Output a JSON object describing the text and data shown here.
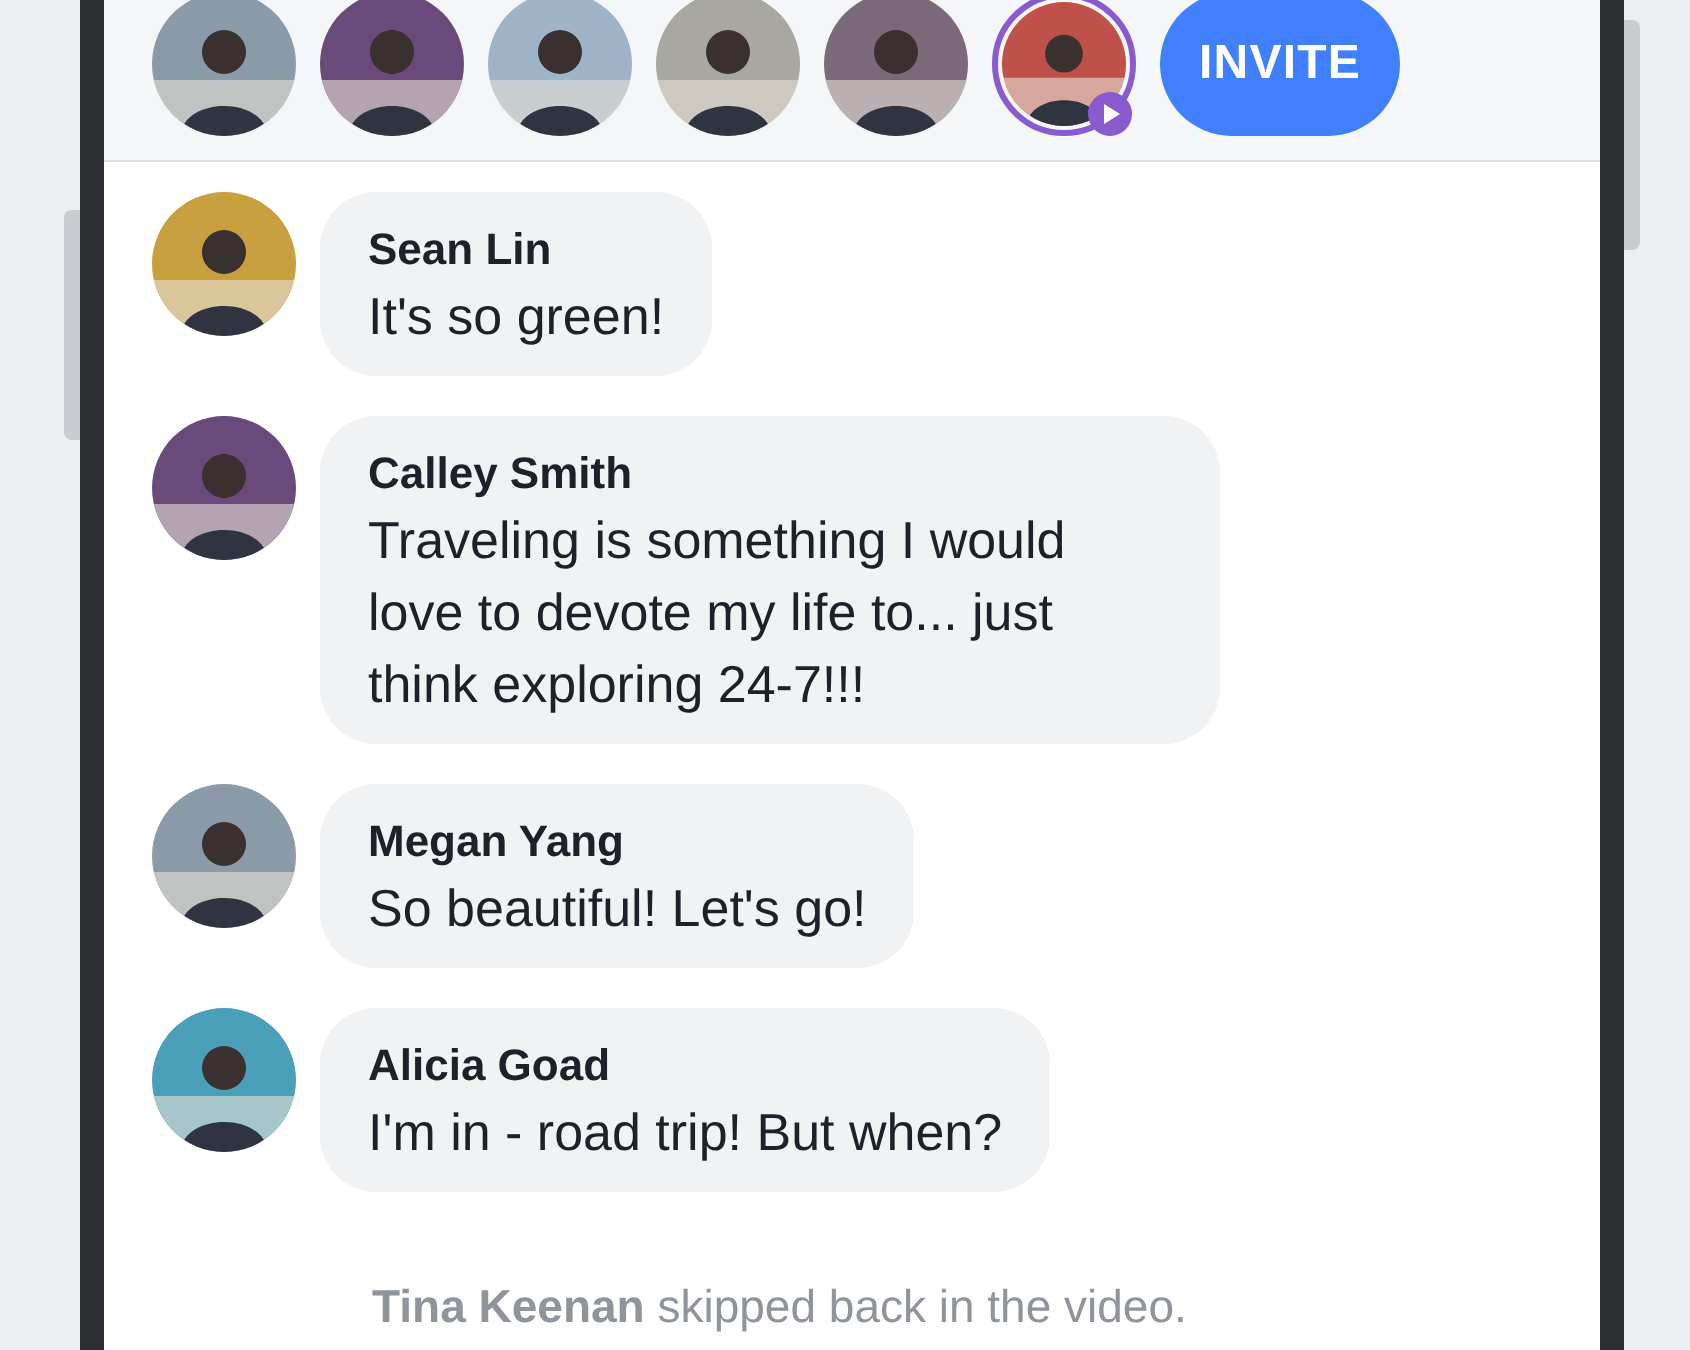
{
  "viewers": [
    {
      "kind": "picture",
      "live": false
    },
    {
      "kind": "picture",
      "live": false
    },
    {
      "kind": "picture",
      "live": false
    },
    {
      "kind": "picture",
      "live": false
    },
    {
      "kind": "picture",
      "live": false
    },
    {
      "kind": "picture",
      "live": true
    }
  ],
  "invite_button": "INVITE",
  "messages": [
    {
      "name": "Sean Lin",
      "text": "It's so green!"
    },
    {
      "name": "Calley Smith",
      "text": "Traveling is something I would love to devote my life to... just think exploring 24-7!!!"
    },
    {
      "name": "Megan Yang",
      "text": "So beautiful! Let's go!"
    },
    {
      "name": "Alicia Goad",
      "text": "I'm in - road trip! But when?"
    }
  ],
  "system_message": {
    "actor": "Tina Keenan",
    "text": "skipped back in the video."
  }
}
